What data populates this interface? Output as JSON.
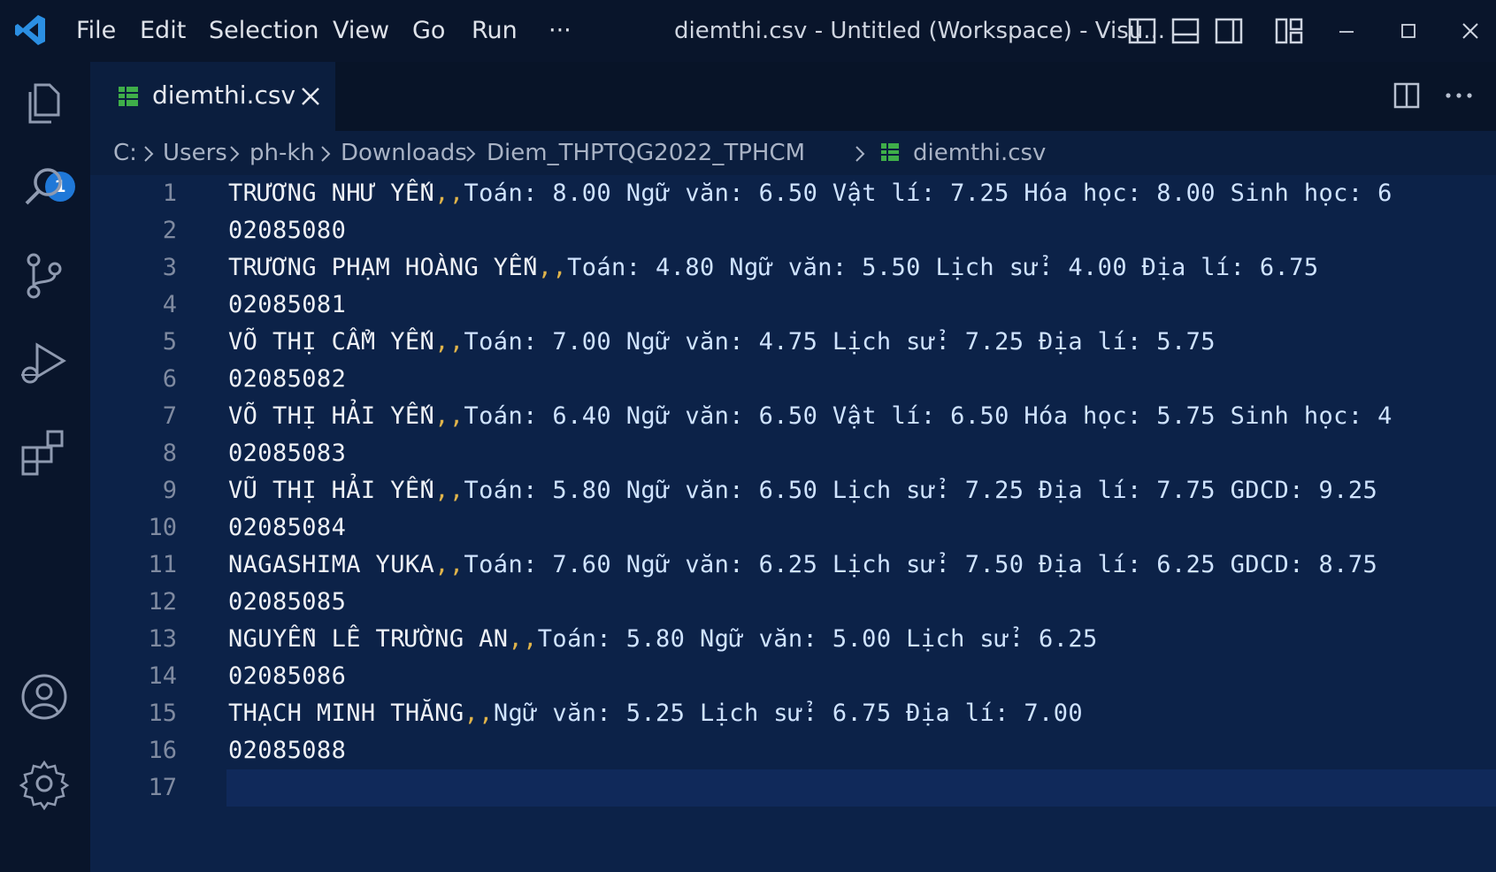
{
  "titlebar": {
    "menu": [
      "File",
      "Edit",
      "Selection",
      "View",
      "Go",
      "Run",
      "···"
    ],
    "window_title": "diemthi.csv - Untitled (Workspace) - Visu..."
  },
  "activity_bar": {
    "explorer_badge": "1",
    "items": [
      "files-icon",
      "search-icon",
      "source-control-icon",
      "run-debug-icon",
      "extensions-icon",
      "account-icon",
      "settings-gear-icon"
    ]
  },
  "tab": {
    "label": "diemthi.csv"
  },
  "breadcrumb": [
    "C:",
    "Users",
    "ph-kh",
    "Downloads",
    "Diem_THPTQG2022_TPHCM",
    "diemthi.csv"
  ],
  "editor": {
    "lines": [
      {
        "n": "1",
        "name": "TRƯƠNG NHƯ YẾN",
        "sep": ",,",
        "rest": "Toán: 8.00 Ngữ văn: 6.50 Vật lí: 7.25 Hóa học: 8.00 Sinh học: 6"
      },
      {
        "n": "2",
        "name": "02085080",
        "sep": "",
        "rest": ""
      },
      {
        "n": "3",
        "name": "TRƯƠNG PHẠM HOÀNG YẾN",
        "sep": ",,",
        "rest": "Toán: 4.80 Ngữ văn: 5.50 Lịch sử: 4.00 Địa lí: 6.75"
      },
      {
        "n": "4",
        "name": "02085081",
        "sep": "",
        "rest": ""
      },
      {
        "n": "5",
        "name": "VÕ THỊ CẨM YẾN",
        "sep": ",,",
        "rest": "Toán: 7.00 Ngữ văn: 4.75 Lịch sử: 7.25 Địa lí: 5.75"
      },
      {
        "n": "6",
        "name": "02085082",
        "sep": "",
        "rest": ""
      },
      {
        "n": "7",
        "name": "VÕ THỊ HẢI YẾN",
        "sep": ",,",
        "rest": "Toán: 6.40 Ngữ văn: 6.50 Vật lí: 6.50 Hóa học: 5.75 Sinh học: 4"
      },
      {
        "n": "8",
        "name": "02085083",
        "sep": "",
        "rest": ""
      },
      {
        "n": "9",
        "name": "VŨ THỊ HẢI YẾN",
        "sep": ",,",
        "rest": "Toán: 5.80 Ngữ văn: 6.50 Lịch sử: 7.25 Địa lí: 7.75 GDCD: 9.25"
      },
      {
        "n": "10",
        "name": "02085084",
        "sep": "",
        "rest": ""
      },
      {
        "n": "11",
        "name": "NAGASHIMA YUKA",
        "sep": ",,",
        "rest": "Toán: 7.60 Ngữ văn: 6.25 Lịch sử: 7.50 Địa lí: 6.25 GDCD: 8.75"
      },
      {
        "n": "12",
        "name": "02085085",
        "sep": "",
        "rest": ""
      },
      {
        "n": "13",
        "name": "NGUYỄN LÊ TRƯỜNG AN",
        "sep": ",,",
        "rest": "Toán: 5.80 Ngữ văn: 5.00 Lịch sử: 6.25"
      },
      {
        "n": "14",
        "name": "02085086",
        "sep": "",
        "rest": ""
      },
      {
        "n": "15",
        "name": "THẠCH MINH THĂNG",
        "sep": ",,",
        "rest": "Ngữ văn: 5.25 Lịch sử: 6.75 Địa lí: 7.00"
      },
      {
        "n": "16",
        "name": "02085088",
        "sep": "",
        "rest": ""
      },
      {
        "n": "17",
        "name": "",
        "sep": "",
        "rest": ""
      }
    ]
  },
  "colors": {
    "editor_bg": "#0c2248",
    "chrome_bg": "#09152b",
    "accent": "#1f78d8",
    "csv_icon": "#3fae49"
  }
}
